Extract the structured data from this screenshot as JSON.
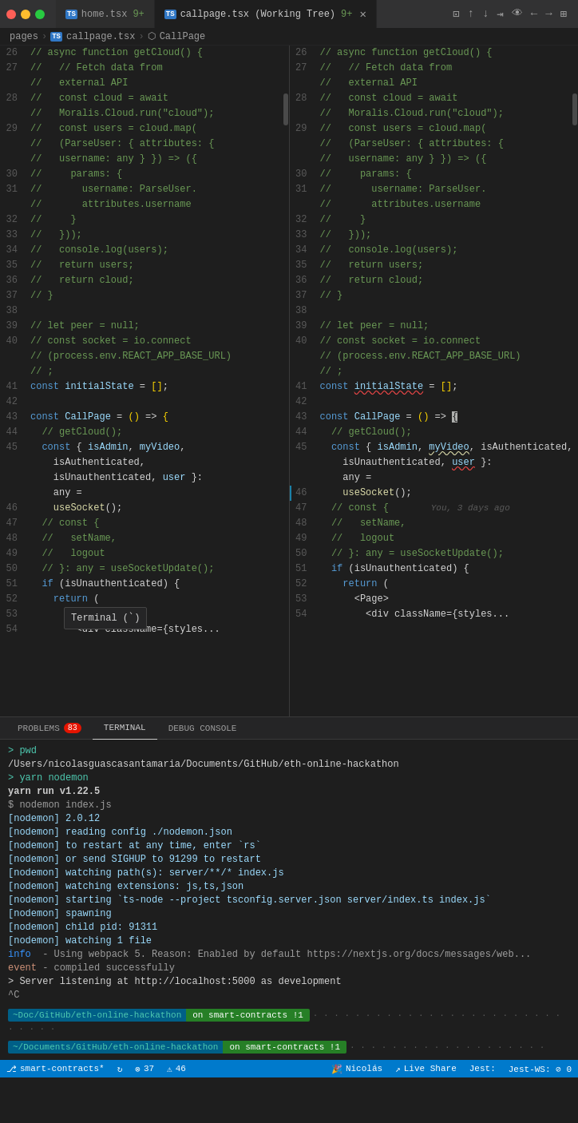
{
  "window": {
    "traffic_lights": [
      "red",
      "yellow",
      "green"
    ]
  },
  "tabs": [
    {
      "id": "home",
      "icon": "TS",
      "label": "home.tsx",
      "badge": "9+",
      "active": false
    },
    {
      "id": "callpage",
      "icon": "TS",
      "label": "callpage.tsx (Working Tree)",
      "badge": "9+",
      "active": true,
      "closable": true
    }
  ],
  "tab_actions": [
    "split",
    "up",
    "down",
    "word-wrap",
    "preview",
    "back",
    "forward",
    "layout"
  ],
  "breadcrumb": {
    "parts": [
      "pages",
      ">",
      "TS callpage.tsx",
      ">",
      "CallPage"
    ]
  },
  "left_pane": {
    "lines": [
      {
        "num": "26",
        "tokens": [
          {
            "t": "c-comment",
            "v": "// async function getCloud() {"
          }
        ]
      },
      {
        "num": "27",
        "tokens": [
          {
            "t": "c-comment",
            "v": "//   // Fetch data from external API"
          }
        ]
      },
      {
        "num": "28",
        "tokens": [
          {
            "t": "c-comment",
            "v": "//   const cloud = await Moralis.Cloud.run(\"cloud\");"
          }
        ]
      },
      {
        "num": "29",
        "tokens": [
          {
            "t": "c-comment",
            "v": "//   const users = cloud.map((ParseUser: { attributes: { username: any } }) => ({"
          }
        ]
      },
      {
        "num": "30",
        "tokens": [
          {
            "t": "c-comment",
            "v": "//     params: {"
          }
        ]
      },
      {
        "num": "31",
        "tokens": [
          {
            "t": "c-comment",
            "v": "//       username: ParseUser.attributes.username"
          }
        ]
      },
      {
        "num": "32",
        "tokens": [
          {
            "t": "c-comment",
            "v": "//     }"
          }
        ]
      },
      {
        "num": "33",
        "tokens": [
          {
            "t": "c-comment",
            "v": "//   }));"
          }
        ]
      },
      {
        "num": "34",
        "tokens": [
          {
            "t": "c-comment",
            "v": "//   console.log(users);"
          }
        ]
      },
      {
        "num": "35",
        "tokens": [
          {
            "t": "c-comment",
            "v": "//   return users;"
          }
        ]
      },
      {
        "num": "36",
        "tokens": [
          {
            "t": "c-comment",
            "v": "//   return cloud;"
          }
        ]
      },
      {
        "num": "37",
        "tokens": [
          {
            "t": "c-comment",
            "v": "// }"
          }
        ]
      },
      {
        "num": "38",
        "tokens": [
          {
            "t": "c-plain",
            "v": ""
          }
        ]
      },
      {
        "num": "39",
        "tokens": [
          {
            "t": "c-comment",
            "v": "// let peer = null;"
          }
        ]
      },
      {
        "num": "40",
        "tokens": [
          {
            "t": "c-comment",
            "v": "// const socket = io.connect(process.env.REACT_APP_BASE_URL);"
          }
        ]
      },
      {
        "num": "41",
        "tokens": [
          {
            "t": "c-keyword",
            "v": "const "
          },
          {
            "t": "c-variable",
            "v": "initialState"
          },
          {
            "t": "c-plain",
            "v": " = "
          },
          {
            "t": "c-bracket",
            "v": "[]"
          },
          {
            "t": "c-plain",
            "v": ";"
          }
        ]
      },
      {
        "num": "42",
        "tokens": [
          {
            "t": "c-plain",
            "v": ""
          }
        ]
      },
      {
        "num": "43",
        "tokens": [
          {
            "t": "c-keyword",
            "v": "const "
          },
          {
            "t": "c-variable",
            "v": "CallPage"
          },
          {
            "t": "c-plain",
            "v": " = "
          },
          {
            "t": "c-bracket",
            "v": "()"
          },
          {
            "t": "c-plain",
            "v": " => "
          },
          {
            "t": "c-bracket",
            "v": "{"
          }
        ]
      },
      {
        "num": "44",
        "tokens": [
          {
            "t": "c-plain",
            "v": "  "
          },
          {
            "t": "c-comment",
            "v": "// getCloud();"
          }
        ]
      },
      {
        "num": "45",
        "tokens": [
          {
            "t": "c-plain",
            "v": "  "
          },
          {
            "t": "c-keyword",
            "v": "const"
          },
          {
            "t": "c-plain",
            "v": " { "
          },
          {
            "t": "c-variable",
            "v": "isAdmin"
          },
          {
            "t": "c-plain",
            "v": ", "
          },
          {
            "t": "c-variable",
            "v": "myVideo"
          },
          {
            "t": "c-plain",
            "v": ", isAuthenticated,"
          }
        ]
      },
      {
        "num": "",
        "tokens": [
          {
            "t": "c-plain",
            "v": "    isUnauthenticated, "
          },
          {
            "t": "c-variable",
            "v": "user"
          },
          {
            "t": "c-plain",
            "v": " }:"
          }
        ]
      },
      {
        "num": "",
        "tokens": [
          {
            "t": "c-plain",
            "v": "    any ="
          }
        ]
      },
      {
        "num": "46",
        "tokens": [
          {
            "t": "c-plain",
            "v": "    "
          },
          {
            "t": "c-function",
            "v": "useSocket"
          },
          {
            "t": "c-plain",
            "v": "();"
          }
        ]
      },
      {
        "num": "47",
        "tokens": [
          {
            "t": "c-plain",
            "v": "  "
          },
          {
            "t": "c-comment",
            "v": "// const {"
          }
        ]
      },
      {
        "num": "48",
        "tokens": [
          {
            "t": "c-plain",
            "v": "  "
          },
          {
            "t": "c-comment",
            "v": "//   setName,"
          }
        ]
      },
      {
        "num": "49",
        "tokens": [
          {
            "t": "c-plain",
            "v": "  "
          },
          {
            "t": "c-comment",
            "v": "//   logout"
          }
        ]
      },
      {
        "num": "50",
        "tokens": [
          {
            "t": "c-plain",
            "v": "  "
          },
          {
            "t": "c-comment",
            "v": "// }: any = useSocketUpdate();"
          }
        ]
      },
      {
        "num": "51",
        "tokens": [
          {
            "t": "c-plain",
            "v": "  "
          },
          {
            "t": "c-keyword",
            "v": "if"
          },
          {
            "t": "c-plain",
            "v": " (isUnauthenticated) {"
          }
        ]
      },
      {
        "num": "52",
        "tokens": [
          {
            "t": "c-plain",
            "v": "    "
          },
          {
            "t": "c-keyword",
            "v": "return"
          },
          {
            "t": "c-plain",
            "v": " ("
          }
        ]
      },
      {
        "num": "53",
        "tokens": [
          {
            "t": "c-plain",
            "v": "      <"
          },
          {
            "t": "c-plain",
            "v": "Pa"
          },
          {
            "t": "c-plain",
            "v": "..."
          }
        ]
      },
      {
        "num": "54",
        "tokens": [
          {
            "t": "c-plain",
            "v": "        <div className={styles..."
          }
        ]
      }
    ]
  },
  "right_pane": {
    "lines": [
      {
        "num": "26",
        "tokens": [
          {
            "t": "c-comment",
            "v": "// async function getCloud() {"
          }
        ]
      },
      {
        "num": "27",
        "tokens": [
          {
            "t": "c-comment",
            "v": "//   // Fetch data from external API"
          }
        ]
      },
      {
        "num": "28",
        "tokens": [
          {
            "t": "c-comment",
            "v": "//   const cloud = await Moralis.Cloud.run(\"cloud\");"
          }
        ]
      },
      {
        "num": "29",
        "tokens": [
          {
            "t": "c-comment",
            "v": "//   const users = cloud.map((ParseUser: { attributes: { username: any } }) => ({"
          }
        ]
      },
      {
        "num": "30",
        "tokens": [
          {
            "t": "c-comment",
            "v": "//     params: {"
          }
        ]
      },
      {
        "num": "31",
        "tokens": [
          {
            "t": "c-comment",
            "v": "//       username: ParseUser.attributes.username"
          }
        ]
      },
      {
        "num": "32",
        "tokens": [
          {
            "t": "c-comment",
            "v": "//     }"
          }
        ]
      },
      {
        "num": "33",
        "tokens": [
          {
            "t": "c-comment",
            "v": "//   }));"
          }
        ]
      },
      {
        "num": "34",
        "tokens": [
          {
            "t": "c-comment",
            "v": "//   console.log(users);"
          }
        ]
      },
      {
        "num": "35",
        "tokens": [
          {
            "t": "c-comment",
            "v": "//   return users;"
          }
        ]
      },
      {
        "num": "36",
        "tokens": [
          {
            "t": "c-comment",
            "v": "//   return cloud;"
          }
        ]
      },
      {
        "num": "37",
        "tokens": [
          {
            "t": "c-comment",
            "v": "// }"
          }
        ]
      },
      {
        "num": "38",
        "tokens": [
          {
            "t": "c-plain",
            "v": ""
          }
        ]
      },
      {
        "num": "39",
        "tokens": [
          {
            "t": "c-comment",
            "v": "// let peer = null;"
          }
        ]
      },
      {
        "num": "40",
        "tokens": [
          {
            "t": "c-comment",
            "v": "// const socket = io.connect(process.env.REACT_APP_BASE_URL);"
          }
        ]
      },
      {
        "num": "41",
        "tokens": [
          {
            "t": "c-keyword",
            "v": "const "
          },
          {
            "t": "c-variable",
            "v": "initialState"
          },
          {
            "t": "c-plain",
            "v": " = "
          },
          {
            "t": "c-bracket",
            "v": "[]"
          },
          {
            "t": "c-plain",
            "v": ";"
          }
        ]
      },
      {
        "num": "42",
        "tokens": [
          {
            "t": "c-plain",
            "v": ""
          }
        ]
      },
      {
        "num": "43",
        "tokens": [
          {
            "t": "c-keyword",
            "v": "const "
          },
          {
            "t": "c-variable",
            "v": "CallPage"
          },
          {
            "t": "c-plain",
            "v": " = "
          },
          {
            "t": "c-bracket",
            "v": "()"
          },
          {
            "t": "c-plain",
            "v": " => "
          },
          {
            "t": "c-cursor",
            "v": "{"
          }
        ]
      },
      {
        "num": "44",
        "tokens": [
          {
            "t": "c-plain",
            "v": "  "
          },
          {
            "t": "c-comment",
            "v": "// getCloud();"
          }
        ]
      },
      {
        "num": "45",
        "tokens": [
          {
            "t": "c-plain",
            "v": "  "
          },
          {
            "t": "c-keyword",
            "v": "const"
          },
          {
            "t": "c-plain",
            "v": " { "
          },
          {
            "t": "c-variable",
            "v": "isAdmin"
          },
          {
            "t": "c-plain",
            "v": ", "
          },
          {
            "t": "c-underline-yellow",
            "v": "myVideo"
          },
          {
            "t": "c-plain",
            "v": ", isAuthenticated,"
          }
        ]
      },
      {
        "num": "",
        "tokens": [
          {
            "t": "c-plain",
            "v": "    isUnauthenticated, "
          },
          {
            "t": "c-underline",
            "v": "user"
          },
          {
            "t": "c-plain",
            "v": " }:"
          }
        ]
      },
      {
        "num": "",
        "tokens": [
          {
            "t": "c-plain",
            "v": "    any ="
          }
        ]
      },
      {
        "num": "46",
        "tokens": [
          {
            "t": "c-git-mod",
            "v": "    "
          },
          {
            "t": "c-function",
            "v": "useSocket"
          },
          {
            "t": "c-plain",
            "v": "();"
          }
        ]
      },
      {
        "num": "47",
        "tokens": [
          {
            "t": "c-plain",
            "v": "  "
          },
          {
            "t": "c-comment",
            "v": "// const {"
          },
          {
            "t": "blame",
            "v": "    You, 3 days ago"
          }
        ]
      },
      {
        "num": "48",
        "tokens": [
          {
            "t": "c-plain",
            "v": "  "
          },
          {
            "t": "c-comment",
            "v": "//   setName,"
          }
        ]
      },
      {
        "num": "49",
        "tokens": [
          {
            "t": "c-plain",
            "v": "  "
          },
          {
            "t": "c-comment",
            "v": "//   logout"
          }
        ]
      },
      {
        "num": "50",
        "tokens": [
          {
            "t": "c-plain",
            "v": "  "
          },
          {
            "t": "c-comment",
            "v": "// }: any = useSocketUpdate();"
          }
        ]
      },
      {
        "num": "51",
        "tokens": [
          {
            "t": "c-plain",
            "v": "  "
          },
          {
            "t": "c-keyword",
            "v": "if"
          },
          {
            "t": "c-plain",
            "v": " (isUnauthenticated) {"
          }
        ]
      },
      {
        "num": "52",
        "tokens": [
          {
            "t": "c-plain",
            "v": "    "
          },
          {
            "t": "c-keyword",
            "v": "return"
          },
          {
            "t": "c-plain",
            "v": " ("
          }
        ]
      },
      {
        "num": "53",
        "tokens": [
          {
            "t": "c-plain",
            "v": "      <Page>"
          }
        ]
      },
      {
        "num": "54",
        "tokens": [
          {
            "t": "c-plain",
            "v": "        <div className={styles..."
          }
        ]
      }
    ]
  },
  "tooltip": {
    "text": "Terminal (`)",
    "visible": true
  },
  "panel": {
    "tabs": [
      {
        "id": "problems",
        "label": "PROBLEMS",
        "badge": "83",
        "active": false
      },
      {
        "id": "terminal",
        "label": "TERMINAL",
        "active": true
      },
      {
        "id": "debug",
        "label": "DEBUG CONSOLE",
        "active": false
      }
    ],
    "terminal": {
      "lines": [
        {
          "type": "prompt",
          "text": "> pwd"
        },
        {
          "type": "path",
          "text": "/Users/nicolasguascasantamaria/Documents/GitHub/eth-online-hackathon"
        },
        {
          "type": "prompt",
          "text": "> yarn nodemon"
        },
        {
          "type": "bold",
          "text": "yarn run v1.22.5"
        },
        {
          "type": "cmd",
          "text": "$ nodemon index.js"
        },
        {
          "type": "nodemon",
          "text": "[nodemon] 2.0.12"
        },
        {
          "type": "nodemon",
          "text": "[nodemon] reading config ./nodemon.json"
        },
        {
          "type": "nodemon",
          "text": "[nodemon] to restart at any time, enter `rs`"
        },
        {
          "type": "nodemon",
          "text": "[nodemon] or send SIGHUP to 91299 to restart"
        },
        {
          "type": "nodemon",
          "text": "[nodemon] watching path(s): server/**/* index.js"
        },
        {
          "type": "nodemon",
          "text": "[nodemon] watching extensions: js,ts,json"
        },
        {
          "type": "nodemon",
          "text": "[nodemon] starting `ts-node --project tsconfig.server.json server/index.ts index.js`"
        },
        {
          "type": "nodemon",
          "text": "[nodemon] spawning"
        },
        {
          "type": "nodemon",
          "text": "[nodemon] child pid: 91311"
        },
        {
          "type": "nodemon",
          "text": "[nodemon] watching 1 file"
        },
        {
          "type": "info",
          "text": "info  - Using webpack 5. Reason: Enabled by default https://nextjs.org/docs/messages/web..."
        },
        {
          "type": "event",
          "text": "event - compiled successfully"
        },
        {
          "type": "server",
          "text": "> Server listening at http://localhost:5000 as development"
        },
        {
          "type": "ctrl",
          "text": "^C"
        }
      ]
    },
    "terminal_blocks": [
      {
        "cwd": "~Doc/GitHub/eth-online-hackathon",
        "branch": "on  smart-contracts !1",
        "dots": true
      },
      {
        "cwd": "~/Documents/GitHub/eth-online-hackathon",
        "branch": "on  smart-contracts !1",
        "dots": true
      }
    ]
  },
  "status_bar": {
    "left": [
      {
        "id": "branch",
        "icon": "⎇",
        "text": "smart-contracts*",
        "extra": ""
      },
      {
        "id": "sync",
        "icon": "↻",
        "text": ""
      },
      {
        "id": "errors",
        "icon": "⊗",
        "text": "37"
      },
      {
        "id": "warnings",
        "icon": "⚠",
        "text": "46"
      }
    ],
    "right": [
      {
        "id": "user",
        "icon": "👨‍💻",
        "text": "Nicolás"
      },
      {
        "id": "liveshare",
        "icon": "⟳",
        "text": "Live Share"
      },
      {
        "id": "jest",
        "icon": "",
        "text": "Jest:"
      },
      {
        "id": "jest-ws",
        "icon": "",
        "text": "Jest-WS: ⊘ 0"
      }
    ]
  }
}
